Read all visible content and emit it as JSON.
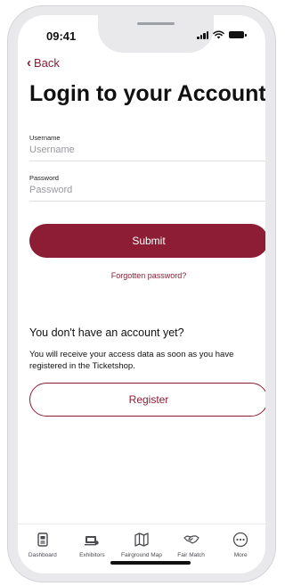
{
  "status_bar": {
    "time": "09:41"
  },
  "nav": {
    "back_label": "Back"
  },
  "page": {
    "title": "Login to your Account"
  },
  "form": {
    "username": {
      "label": "Username",
      "placeholder": "Username",
      "value": ""
    },
    "password": {
      "label": "Password",
      "placeholder": "Password",
      "value": ""
    },
    "submit_label": "Submit",
    "forgot_label": "Forgotten password?"
  },
  "register_section": {
    "title": "You don't have an account yet?",
    "text": "You will receive your access data as soon as you have registered in the Ticketshop.",
    "register_label": "Register"
  },
  "tabbar": {
    "items": [
      {
        "label": "Dashboard",
        "icon": "dashboard-icon"
      },
      {
        "label": "Exhibitors",
        "icon": "exhibitors-icon"
      },
      {
        "label": "Fairground Map",
        "icon": "map-icon"
      },
      {
        "label": "Fair Match",
        "icon": "handshake-icon"
      },
      {
        "label": "More",
        "icon": "more-icon"
      }
    ]
  },
  "colors": {
    "accent": "#8c1d35",
    "text": "#111111",
    "muted": "#9a9aa0"
  }
}
